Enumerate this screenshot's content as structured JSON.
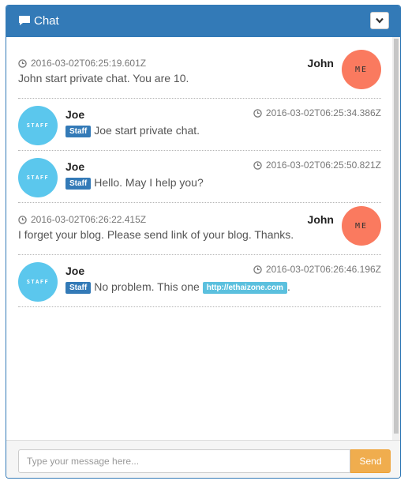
{
  "panel": {
    "title": "Chat",
    "icon": "comment-icon",
    "collapse_icon": "chevron-down-icon"
  },
  "messages": [
    {
      "side": "right",
      "name": "John",
      "avatar": "ME",
      "time": "2016-03-02T06:25:19.601Z",
      "text": "John start private chat. You are 10."
    },
    {
      "side": "left",
      "name": "Joe",
      "avatar": "STAFF",
      "time": "2016-03-02T06:25:34.386Z",
      "badge": "Staff",
      "text": "Joe start private chat."
    },
    {
      "side": "left",
      "name": "Joe",
      "avatar": "STAFF",
      "time": "2016-03-02T06:25:50.821Z",
      "badge": "Staff",
      "text": "Hello. May I help you?"
    },
    {
      "side": "right",
      "name": "John",
      "avatar": "ME",
      "time": "2016-03-02T06:26:22.415Z",
      "text": "I forget your blog. Please send link of your blog. Thanks."
    },
    {
      "side": "left",
      "name": "Joe",
      "avatar": "STAFF",
      "time": "2016-03-02T06:26:46.196Z",
      "badge": "Staff",
      "text": "No problem. This one ",
      "link": "http://ethaizone.com",
      "text_after": "."
    }
  ],
  "footer": {
    "placeholder": "Type your message here...",
    "send_label": "Send"
  },
  "colors": {
    "primary": "#337ab7",
    "staff_avatar": "#5bc7ed",
    "me_avatar": "#fa7a5f",
    "send": "#f0ad4e",
    "link_badge": "#5bc0de"
  }
}
